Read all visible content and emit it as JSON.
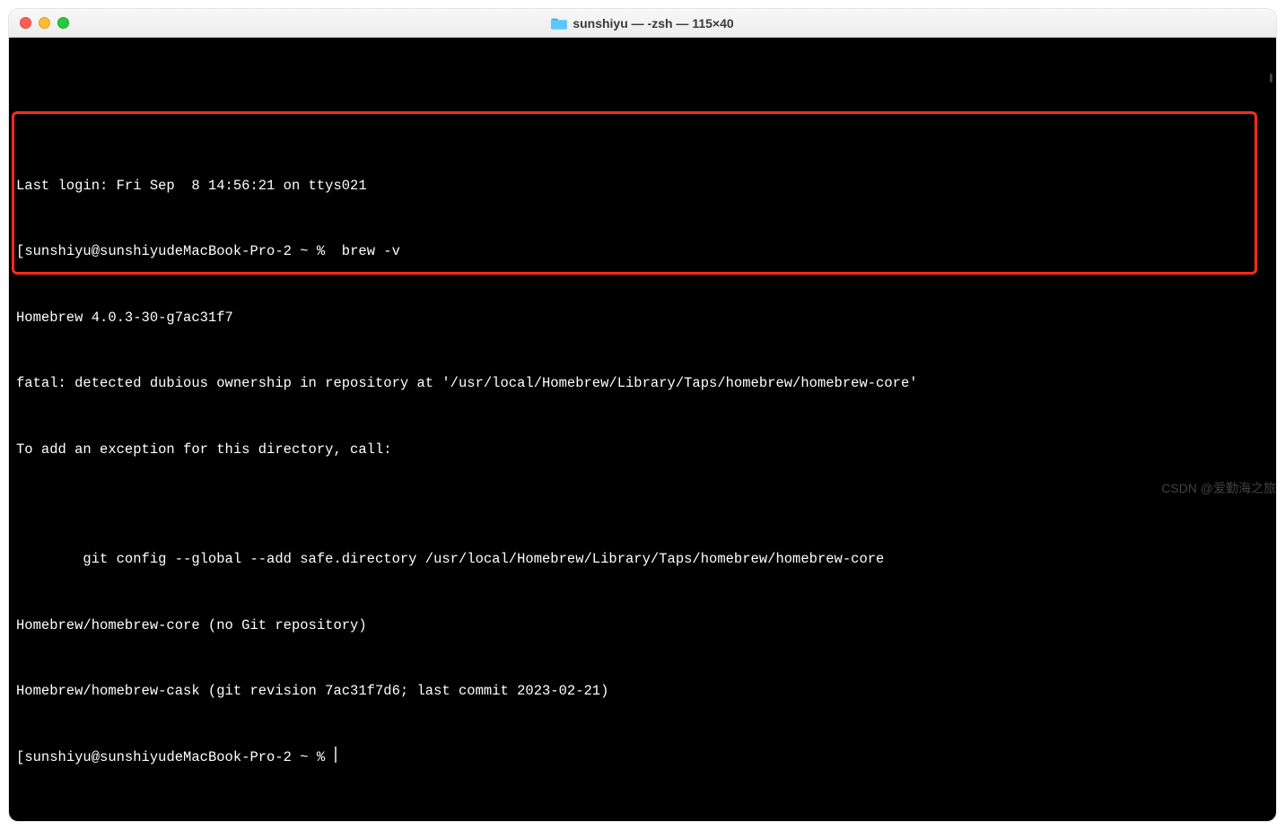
{
  "window": {
    "title": "sunshiyu — -zsh — 115×40"
  },
  "terminal": {
    "lines": {
      "l0": "Last login: Fri Sep  8 14:56:21 on ttys021",
      "l1_prompt_open": "[",
      "l1_user_host": "sunshiyu@sunshiyudeMacBook-Pro-2",
      "l1_path": " ~ % ",
      "l1_cmd": " brew -v",
      "l2": "Homebrew 4.0.3-30-g7ac31f7",
      "l3": "fatal: detected dubious ownership in repository at '/usr/local/Homebrew/Library/Taps/homebrew/homebrew-core'",
      "l4": "To add an exception for this directory, call:",
      "l5": "",
      "l6": "        git config --global --add safe.directory /usr/local/Homebrew/Library/Taps/homebrew/homebrew-core",
      "l7": "Homebrew/homebrew-core (no Git repository)",
      "l8": "Homebrew/homebrew-cask (git revision 7ac31f7d6; last commit 2023-02-21)",
      "l9_prompt_open": "[",
      "l9_user_host": "sunshiyu@sunshiyudeMacBook-Pro-2",
      "l9_path": " ~ % "
    }
  },
  "highlight": {
    "top_px": "82",
    "left_px": "3",
    "width_px": "1388",
    "height_px": "182"
  },
  "watermark": "CSDN @爱勤海之旅"
}
